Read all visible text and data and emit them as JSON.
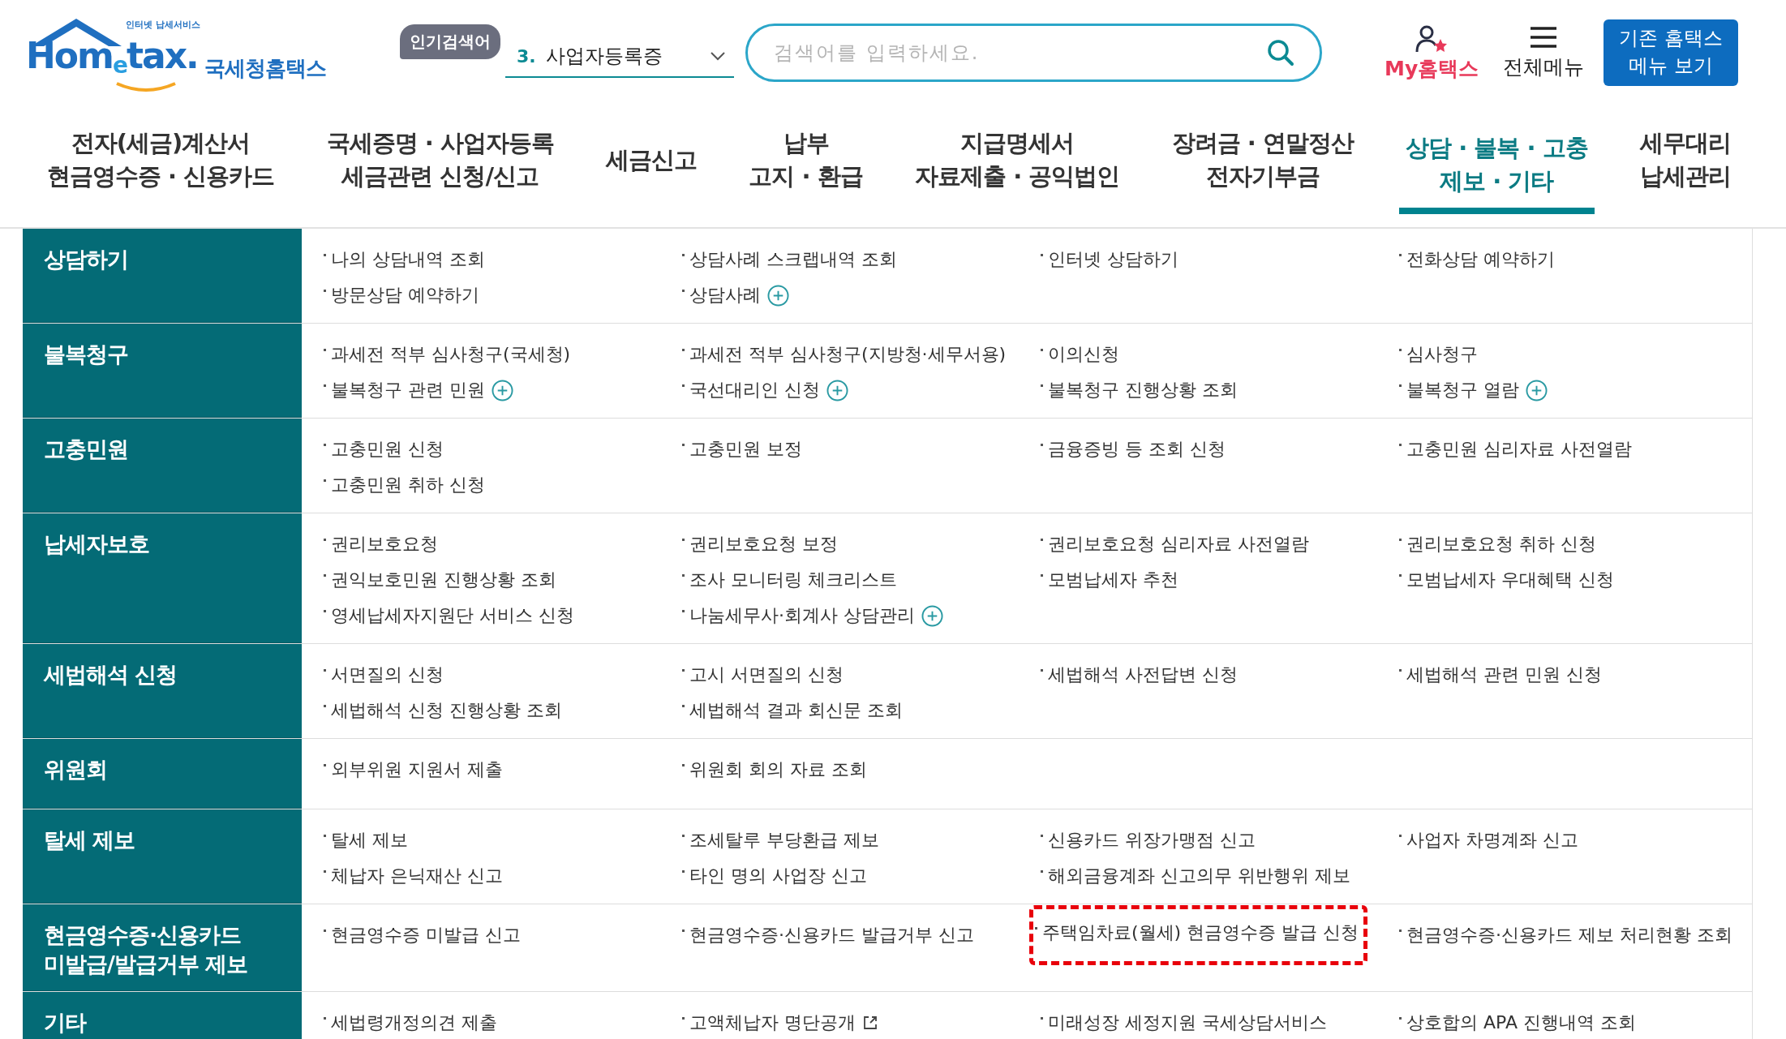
{
  "logo": {
    "tagline": "인터넷 납세서비스",
    "wordmark": "Hom$_{e}$tax.",
    "name": "국세청홈택스"
  },
  "popular_search": {
    "tag": "인기검색어",
    "rank": "3.",
    "term": "사업자등록증"
  },
  "search": {
    "placeholder": "검색어를 입력하세요."
  },
  "my_hometax": {
    "label": "My홈택스"
  },
  "all_menu": {
    "label": "전체메뉴"
  },
  "legacy_button": {
    "lines": [
      "기존 홈택스",
      "메뉴 보기"
    ]
  },
  "nav": [
    {
      "lines": [
        "전자(세금)계산서",
        "현금영수증 · 신용카드"
      ],
      "selected": false
    },
    {
      "lines": [
        "국세증명 · 사업자등록",
        "세금관련 신청/신고"
      ],
      "selected": false
    },
    {
      "lines": [
        "세금신고"
      ],
      "selected": false
    },
    {
      "lines": [
        "납부",
        "고지 · 환급"
      ],
      "selected": false
    },
    {
      "lines": [
        "지급명세서",
        "자료제출 · 공익법인"
      ],
      "selected": false
    },
    {
      "lines": [
        "장려금 · 연말정산",
        "전자기부금"
      ],
      "selected": false
    },
    {
      "lines": [
        "상담 · 불복 · 고충",
        "제보 · 기타"
      ],
      "selected": true
    },
    {
      "lines": [
        "세무대리",
        "납세관리"
      ],
      "selected": false
    }
  ],
  "sections": [
    {
      "title": [
        "상담하기"
      ],
      "items": [
        {
          "text": "나의 상담내역 조회",
          "highlighted": false
        },
        {
          "text": "상담사례 스크랩내역 조회",
          "highlighted": false
        },
        {
          "text": "인터넷 상담하기",
          "highlighted": false
        },
        {
          "text": "전화상담 예약하기",
          "highlighted": false
        },
        {
          "text": "방문상담 예약하기",
          "highlighted": false
        },
        {
          "text": "상담사례",
          "kind": "more",
          "highlighted": false
        }
      ]
    },
    {
      "title": [
        "불복청구"
      ],
      "items": [
        {
          "text": "과세전 적부 심사청구(국세청)",
          "highlighted": false
        },
        {
          "text": "과세전 적부 심사청구(지방청·세무서용)",
          "highlighted": false
        },
        {
          "text": "이의신청",
          "highlighted": false
        },
        {
          "text": "심사청구",
          "highlighted": false
        },
        {
          "text": "불복청구 관련 민원",
          "kind": "more",
          "highlighted": false
        },
        {
          "text": "국선대리인 신청",
          "kind": "more",
          "highlighted": false
        },
        {
          "text": "불복청구 진행상황 조회",
          "highlighted": false
        },
        {
          "text": "불복청구 열람",
          "kind": "more",
          "highlighted": false
        }
      ]
    },
    {
      "title": [
        "고충민원"
      ],
      "items": [
        {
          "text": "고충민원 신청",
          "highlighted": false
        },
        {
          "text": "고충민원 보정",
          "highlighted": false
        },
        {
          "text": "금융증빙 등 조회 신청",
          "highlighted": false
        },
        {
          "text": "고충민원 심리자료 사전열람",
          "highlighted": false
        },
        {
          "text": "고충민원 취하 신청",
          "highlighted": false
        }
      ]
    },
    {
      "title": [
        "납세자보호"
      ],
      "items": [
        {
          "text": "권리보호요청",
          "highlighted": false
        },
        {
          "text": "권리보호요청 보정",
          "highlighted": false
        },
        {
          "text": "권리보호요청 심리자료 사전열람",
          "highlighted": false
        },
        {
          "text": "권리보호요청 취하 신청",
          "highlighted": false
        },
        {
          "text": "권익보호민원 진행상황 조회",
          "highlighted": false
        },
        {
          "text": "조사 모니터링 체크리스트",
          "highlighted": false
        },
        {
          "text": "모범납세자 추천",
          "highlighted": false
        },
        {
          "text": "모범납세자 우대혜택 신청",
          "highlighted": false
        },
        {
          "text": "영세납세자지원단 서비스 신청",
          "highlighted": false
        },
        {
          "text": "나눔세무사·회계사 상담관리",
          "kind": "more",
          "highlighted": false
        }
      ]
    },
    {
      "title": [
        "세법해석 신청"
      ],
      "items": [
        {
          "text": "서면질의 신청",
          "highlighted": false
        },
        {
          "text": "고시 서면질의 신청",
          "highlighted": false
        },
        {
          "text": "세법해석 사전답변 신청",
          "highlighted": false
        },
        {
          "text": "세법해석 관련 민원 신청",
          "highlighted": false
        },
        {
          "text": "세법해석 신청 진행상황 조회",
          "highlighted": false
        },
        {
          "text": "세법해석 결과 회신문 조회",
          "highlighted": false
        }
      ]
    },
    {
      "title": [
        "위원회"
      ],
      "items": [
        {
          "text": "외부위원 지원서 제출",
          "highlighted": false
        },
        {
          "text": "위원회 회의 자료 조회",
          "highlighted": false
        }
      ]
    },
    {
      "title": [
        "탈세 제보"
      ],
      "items": [
        {
          "text": "탈세 제보",
          "highlighted": false
        },
        {
          "text": "조세탈루 부당환급 제보",
          "highlighted": false
        },
        {
          "text": "신용카드 위장가맹점 신고",
          "highlighted": false
        },
        {
          "text": "사업자 차명계좌 신고",
          "highlighted": false
        },
        {
          "text": "체납자 은닉재산 신고",
          "highlighted": false
        },
        {
          "text": "타인 명의 사업장 신고",
          "highlighted": false
        },
        {
          "text": "해외금융계좌 신고의무 위반행위 제보",
          "highlighted": false
        }
      ]
    },
    {
      "title": [
        "현금영수증·신용카드",
        "미발급/발급거부 제보"
      ],
      "items": [
        {
          "text": "현금영수증 미발급 신고",
          "highlighted": false
        },
        {
          "text": "현금영수증·신용카드 발급거부 신고",
          "highlighted": false
        },
        {
          "text": "주택임차료(월세) 현금영수증 발급 신청",
          "highlighted": true
        },
        {
          "text": "현금영수증·신용카드 제보 처리현황 조회",
          "highlighted": false
        }
      ]
    },
    {
      "title": [
        "기타"
      ],
      "items": [
        {
          "text": "세법령개정의견 제출",
          "highlighted": false
        },
        {
          "text": "고액체납자 명단공개",
          "kind": "external",
          "highlighted": false
        },
        {
          "text": "미래성장 세정지원 국세상담서비스",
          "highlighted": false
        },
        {
          "text": "상호합의 APA 진행내역 조회",
          "highlighted": false
        }
      ]
    }
  ]
}
